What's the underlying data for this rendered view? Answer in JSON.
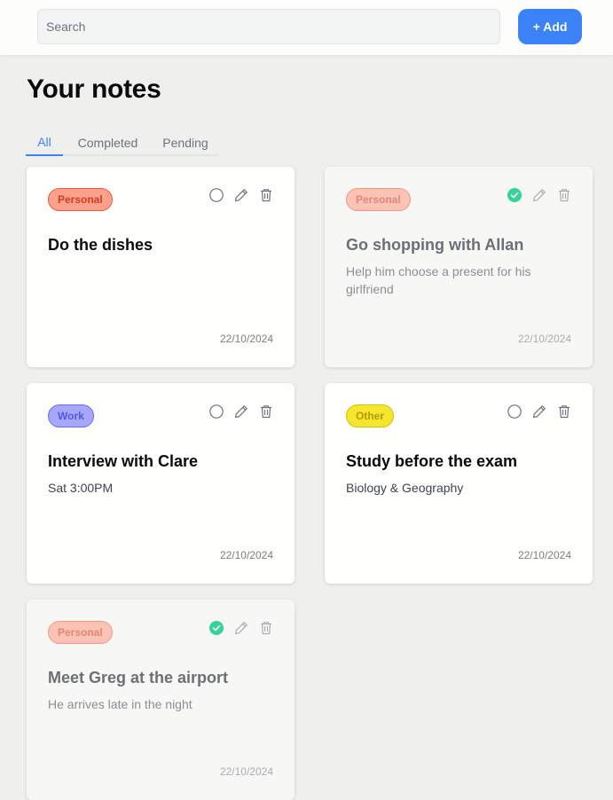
{
  "search": {
    "placeholder": "Search"
  },
  "toolbar": {
    "add_label": "+ Add"
  },
  "page": {
    "title": "Your notes"
  },
  "tabs": [
    {
      "label": "All",
      "active": true
    },
    {
      "label": "Completed",
      "active": false
    },
    {
      "label": "Pending",
      "active": false
    }
  ],
  "colors": {
    "accent": "#3b82f6",
    "check": "#34d399",
    "personal": "#fca28c",
    "work": "#a5a7fa",
    "other": "#f4e62c"
  },
  "icons": {
    "status": "circle-icon",
    "done": "check-circle-icon",
    "edit": "pencil-icon",
    "delete": "trash-icon"
  },
  "notes": [
    {
      "category": "Personal",
      "title": "Do the dishes",
      "description": "",
      "date": "22/10/2024",
      "completed": false
    },
    {
      "category": "Personal",
      "title": "Go shopping with Allan",
      "description": "Help him choose a present for his girlfriend",
      "date": "22/10/2024",
      "completed": true
    },
    {
      "category": "Work",
      "title": "Interview with Clare",
      "description": "Sat 3:00PM",
      "date": "22/10/2024",
      "completed": false
    },
    {
      "category": "Other",
      "title": "Study before the exam",
      "description": "Biology & Geography",
      "date": "22/10/2024",
      "completed": false
    },
    {
      "category": "Personal",
      "title": "Meet Greg at the airport",
      "description": "He arrives late in the night",
      "date": "22/10/2024",
      "completed": true
    }
  ]
}
